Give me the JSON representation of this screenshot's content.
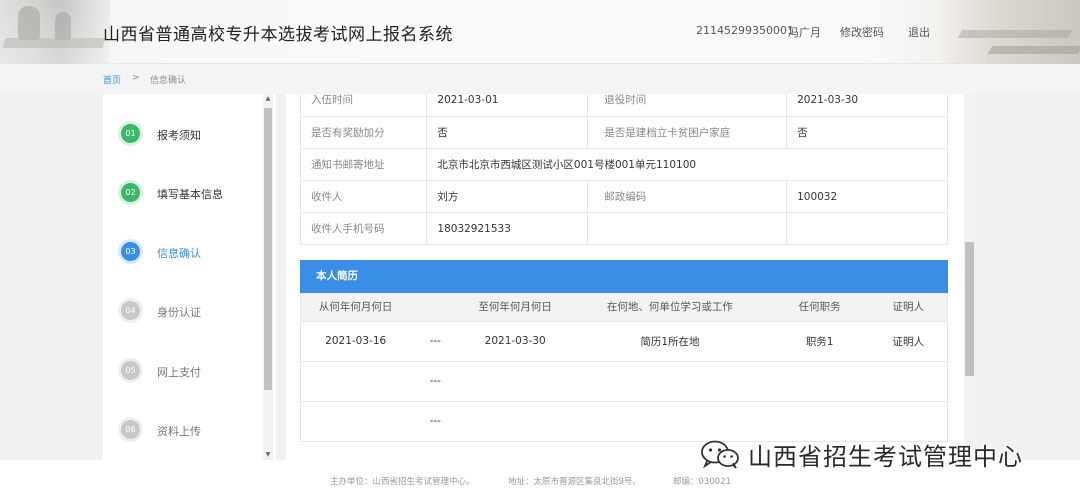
{
  "header": {
    "title": "山西省普通高校专升本选拔考试网上报名系统",
    "user_id": "21145299350001",
    "user_name": "冯广月",
    "change_password": "修改密码",
    "logout": "退出"
  },
  "breadcrumb": {
    "home": "首页",
    "separator": ">",
    "current": "信息确认"
  },
  "steps": [
    {
      "num": "01",
      "label": "报考须知",
      "state": "done"
    },
    {
      "num": "02",
      "label": "填写基本信息",
      "state": "done"
    },
    {
      "num": "03",
      "label": "信息确认",
      "state": "active"
    },
    {
      "num": "04",
      "label": "身份认证",
      "state": "todo"
    },
    {
      "num": "05",
      "label": "网上支付",
      "state": "todo"
    },
    {
      "num": "06",
      "label": "资料上传",
      "state": "todo"
    }
  ],
  "info_rows": [
    {
      "k1": "入伍时间",
      "v1": "2021-03-01",
      "k2": "退役时间",
      "v2": "2021-03-30"
    },
    {
      "k1": "是否有奖励加分",
      "v1": "否",
      "k2": "是否是建档立卡贫困户家庭",
      "v2": "否"
    },
    {
      "k1": "通知书邮寄地址",
      "v1": "北京市北京市西城区测试小区001号楼001单元110100"
    },
    {
      "k1": "收件人",
      "v1": "刘方",
      "k2": "邮政编码",
      "v2": "100032"
    },
    {
      "k1": "收件人手机号码",
      "v1": "18032921533",
      "k2": "",
      "v2": ""
    }
  ],
  "resume": {
    "title": "本人简历",
    "columns": [
      "从何年何月何日",
      "",
      "至何年何月何日",
      "在何地、何单位学习或工作",
      "任何职务",
      "证明人"
    ],
    "rows": [
      [
        "2021-03-16",
        "---",
        "2021-03-30",
        "简历1所在地",
        "职务1",
        "证明人"
      ],
      [
        "",
        "---",
        "",
        "",
        "",
        ""
      ],
      [
        "",
        "---",
        "",
        "",
        "",
        ""
      ]
    ]
  },
  "footer": {
    "org": "主办单位：山西省招生考试管理中心。",
    "address": "地址：太原市晋源区集良北街9号。",
    "zip": "邮编：030021"
  },
  "watermark": {
    "text": "山西省招生考试管理中心",
    "icon": "wechat-icon"
  },
  "colors": {
    "accent": "#3a8ee6",
    "done": "#3cb86a",
    "todo": "#c8c8c8"
  }
}
